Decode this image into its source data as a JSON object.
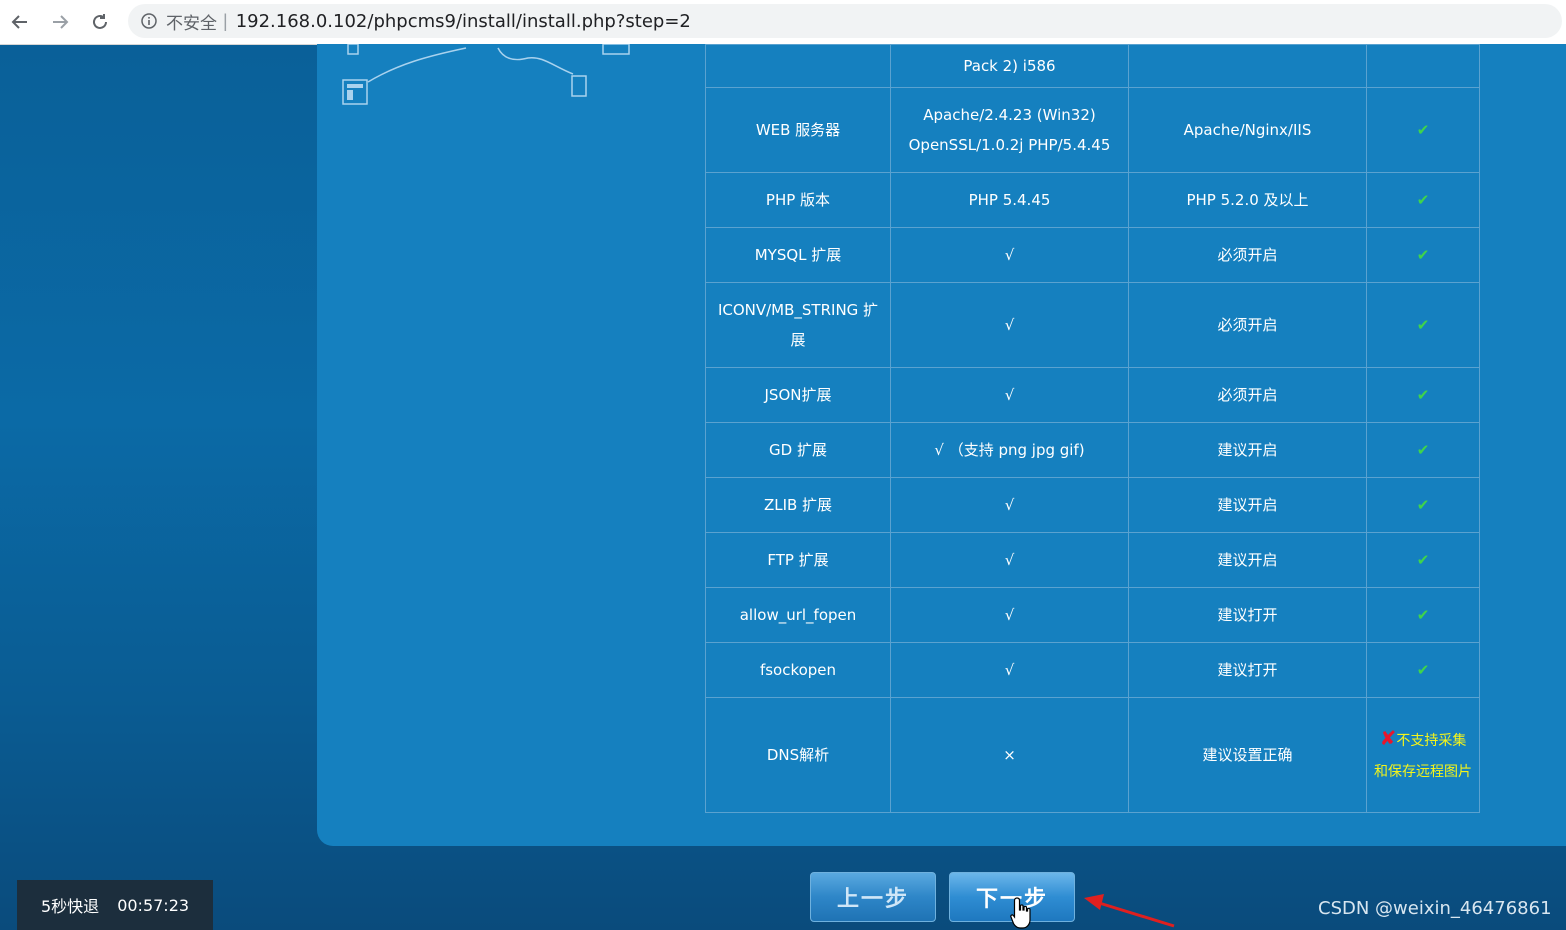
{
  "browser": {
    "insecure_label": "不安全",
    "url": "192.168.0.102/phpcms9/install/install.php?step=2"
  },
  "env_table": {
    "rows": [
      {
        "name": "",
        "current": "Pack 2) i586",
        "required": "",
        "status": ""
      },
      {
        "name": "WEB 服务器",
        "current": "Apache/2.4.23 (Win32) OpenSSL/1.0.2j PHP/5.4.45",
        "required": "Apache/Nginx/IIS",
        "status": "✔"
      },
      {
        "name": "PHP 版本",
        "current": "PHP 5.4.45",
        "required": "PHP 5.2.0 及以上",
        "status": "✔"
      },
      {
        "name": "MYSQL 扩展",
        "current": "√",
        "required": "必须开启",
        "status": "✔"
      },
      {
        "name": "ICONV/MB_STRING 扩展",
        "current": "√",
        "required": "必须开启",
        "status": "✔"
      },
      {
        "name": "JSON扩展",
        "current": "√",
        "required": "必须开启",
        "status": "✔"
      },
      {
        "name": "GD 扩展",
        "current": "√ （支持 png jpg gif)",
        "required": "建议开启",
        "status": "✔"
      },
      {
        "name": "ZLIB 扩展",
        "current": "√",
        "required": "建议开启",
        "status": "✔"
      },
      {
        "name": "FTP 扩展",
        "current": "√",
        "required": "建议开启",
        "status": "✔"
      },
      {
        "name": "allow_url_fopen",
        "current": "√",
        "required": "建议打开",
        "status": "✔"
      },
      {
        "name": "fsockopen",
        "current": "√",
        "required": "建议打开",
        "status": "✔"
      },
      {
        "name": "DNS解析",
        "current": "×",
        "required": "建议设置正确",
        "status": "不支持采集和保存远程图片",
        "status_mark": "✘"
      }
    ]
  },
  "buttons": {
    "prev": "上一步",
    "next": "下一步"
  },
  "overlay": {
    "speed_label": "5秒快退",
    "time": "00:57:23",
    "watermark": "CSDN @weixin_46476861"
  }
}
